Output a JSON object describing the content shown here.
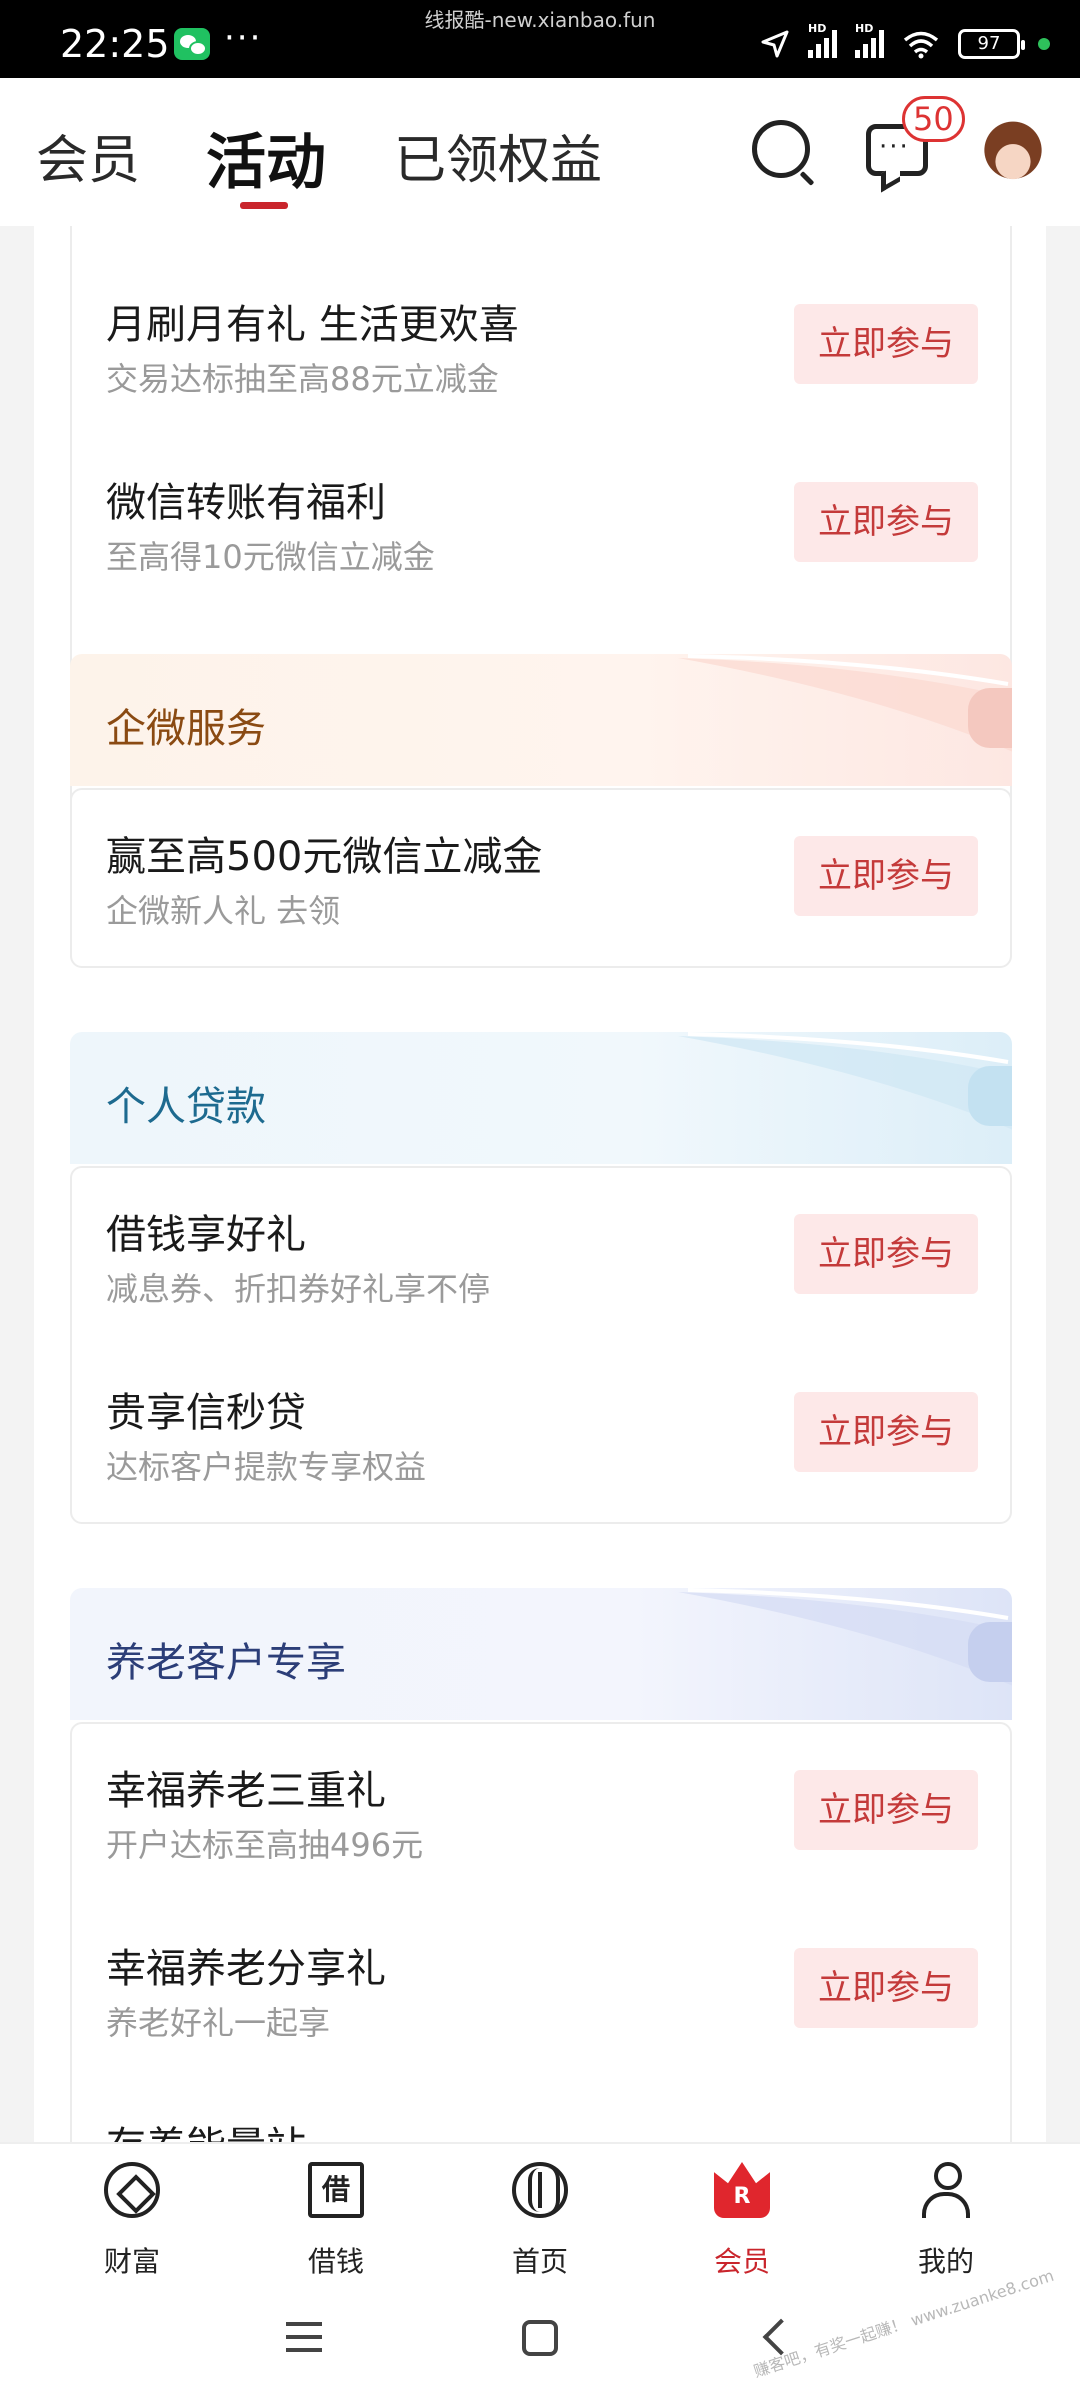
{
  "status_bar": {
    "time": "22:25",
    "more": "···",
    "watermark": "线报酷-new.xianbao.fun",
    "battery": "97",
    "hd1": "HD",
    "hd2": "HD"
  },
  "top_nav": {
    "tabs": [
      "会员",
      "活动",
      "已领权益"
    ],
    "active_tab": "活动",
    "message_badge": "50"
  },
  "sections": {
    "first": {
      "items": [
        {
          "title": "月刷月有礼 生活更欢喜",
          "subtitle": "交易达标抽至高88元立减金",
          "button": "立即参与"
        },
        {
          "title": "微信转账有福利",
          "subtitle": "至高得10元微信立减金",
          "button": "立即参与"
        }
      ]
    },
    "qiwei": {
      "header": "企微服务",
      "items": [
        {
          "title": "赢至高500元微信立减金",
          "subtitle": "企微新人礼 去领",
          "button": "立即参与"
        }
      ]
    },
    "loan": {
      "header": "个人贷款",
      "items": [
        {
          "title": "借钱享好礼",
          "subtitle": "减息券、折扣券好礼享不停",
          "button": "立即参与"
        },
        {
          "title": "贵享信秒贷",
          "subtitle": "达标客户提款专享权益",
          "button": "立即参与"
        }
      ]
    },
    "pension": {
      "header": "养老客户专享",
      "items": [
        {
          "title": "幸福养老三重礼",
          "subtitle": "开户达标至高抽496元",
          "button": "立即参与"
        },
        {
          "title": "幸福养老分享礼",
          "subtitle": "养老好礼一起享",
          "button": "立即参与"
        },
        {
          "title": "存养能量站",
          "subtitle": "",
          "button": ""
        }
      ]
    }
  },
  "bottom_tabs": [
    {
      "label": "财富",
      "icon": "wealth-icon"
    },
    {
      "label": "借钱",
      "icon": "borrow-icon",
      "glyph": "借"
    },
    {
      "label": "首页",
      "icon": "home-icon"
    },
    {
      "label": "会员",
      "icon": "member-crown-icon",
      "glyph": "R",
      "active": true
    },
    {
      "label": "我的",
      "icon": "profile-icon"
    }
  ],
  "bottom_watermark": "赚客吧，有奖一起赚！ www.zuanke8.com",
  "colors": {
    "accent": "#c9252c",
    "button_bg": "#fde8e8",
    "button_text": "#c43a3a",
    "qiwei_label": "#8a4a12",
    "loan_label": "#1d6a8f",
    "pension_label": "#2c3e78"
  }
}
